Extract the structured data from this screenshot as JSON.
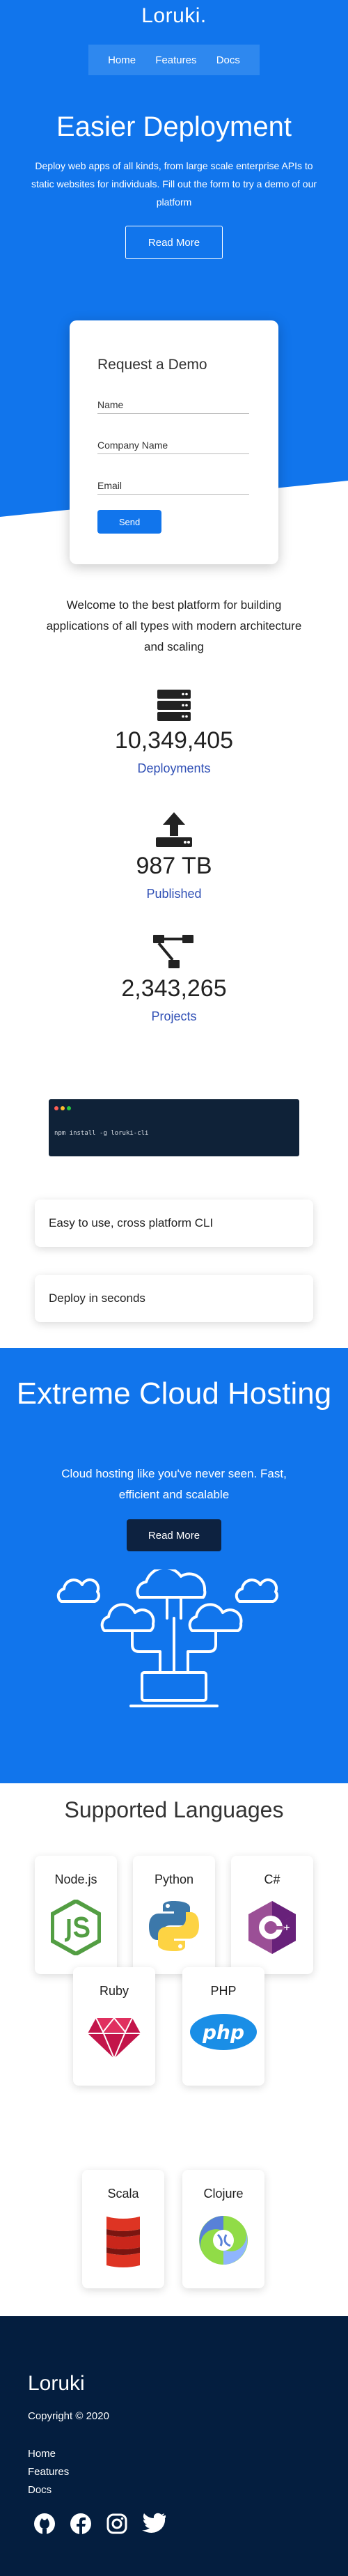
{
  "brand": {
    "name": "Loruki."
  },
  "nav": {
    "items": [
      "Home",
      "Features",
      "Docs"
    ]
  },
  "hero": {
    "title": "Easier Deployment",
    "text": "Deploy web apps of all kinds, from large scale enterprise APIs to static websites for individuals. Fill out the form to try a demo of our platform",
    "button": "Read More"
  },
  "form": {
    "title": "Request a Demo",
    "name_placeholder": "Name",
    "company_placeholder": "Company Name",
    "email_placeholder": "Email",
    "submit": "Send"
  },
  "stats": {
    "welcome": "Welcome to the best platform for building applications of all types with modern architecture and scaling",
    "items": [
      {
        "icon": "server-icon",
        "value": "10,349,405",
        "label": "Deployments"
      },
      {
        "icon": "upload-icon",
        "value": "987 TB",
        "label": "Published"
      },
      {
        "icon": "project-diagram-icon",
        "value": "2,343,265",
        "label": "Projects"
      }
    ]
  },
  "terminal": {
    "command": "npm install -g loruki-cli"
  },
  "features": [
    "Easy to use, cross platform CLI",
    "Deploy in seconds"
  ],
  "cloud": {
    "title": "Extreme Cloud Hosting",
    "text": "Cloud hosting like you've never seen. Fast, efficient and scalable",
    "button": "Read More"
  },
  "languages": {
    "title": "Supported Languages",
    "items": [
      "Node.js",
      "Python",
      "C#",
      "Ruby",
      "PHP",
      "Scala",
      "Clojure"
    ]
  },
  "footer": {
    "logo": "Loruki",
    "copyright": "Copyright © 2020",
    "links": [
      "Home",
      "Features",
      "Docs"
    ],
    "social": [
      "github-icon",
      "facebook-icon",
      "instagram-icon",
      "twitter-icon"
    ]
  },
  "colors": {
    "primary": "#1175ec",
    "dark": "#041e3f",
    "stat_label": "#2f4fb5"
  }
}
